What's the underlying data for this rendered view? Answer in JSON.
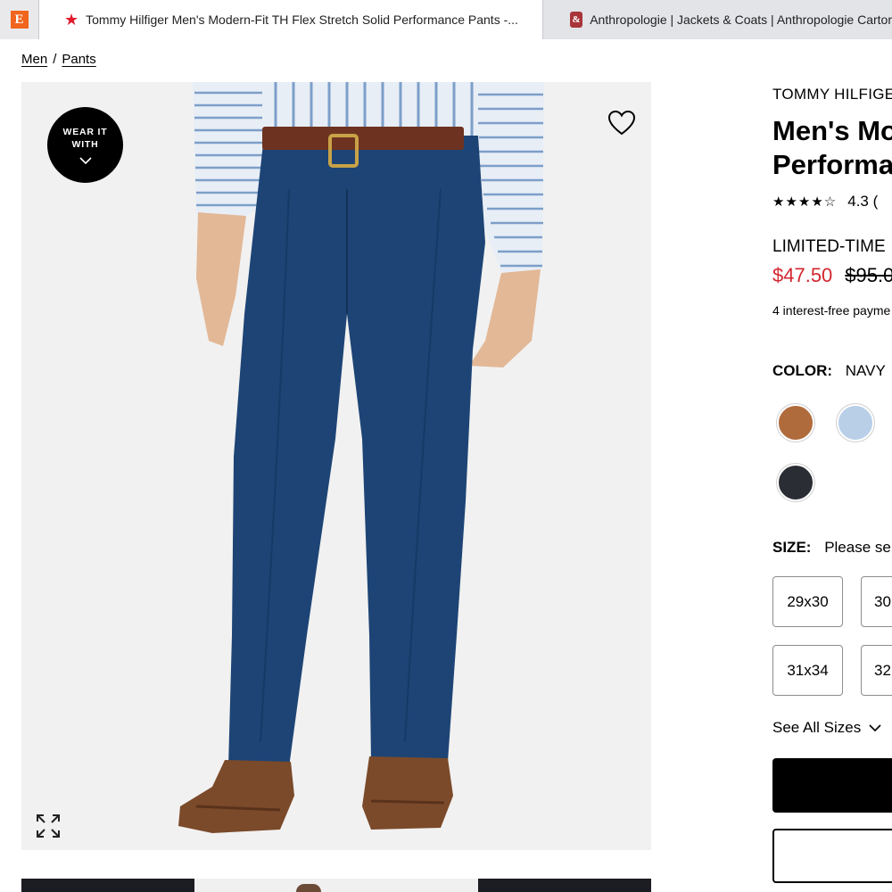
{
  "tabs": [
    {
      "title": "",
      "icon": "etsy-icon"
    },
    {
      "title": "Tommy Hilfiger Men's Modern-Fit TH Flex Stretch Solid Performance Pants -...",
      "icon": "macys-star-icon"
    },
    {
      "title": "Anthropologie | Jackets & Coats | Anthropologie Cartor",
      "icon": "anthropologie-icon"
    }
  ],
  "breadcrumb": [
    "Men",
    "Pants"
  ],
  "hero": {
    "wear_it_line1": "WEAR IT",
    "wear_it_line2": "WITH"
  },
  "product": {
    "brand": "TOMMY HILFIGE",
    "title_line1": "Men's Mo",
    "title_line2": "Performa",
    "rating": "4.3 (",
    "rating_value": 4.3,
    "promo": "LIMITED-TIME",
    "sale_price": "$47.50",
    "original_price": "$95.0",
    "installments": "4 interest-free payme",
    "color_label": "COLOR:",
    "color_value": "NAVY",
    "swatches": [
      {
        "name": "brown",
        "color": "#b06b3c"
      },
      {
        "name": "light-blue",
        "color": "#b9cfe8"
      },
      {
        "name": "charcoal",
        "color": "#2a2d33"
      }
    ],
    "size_label": "SIZE:",
    "size_prompt": "Please sel",
    "sizes": [
      "29x30",
      "30",
      "31x34",
      "32"
    ],
    "see_all": "See All Sizes"
  },
  "colors": {
    "sale": "#d22630",
    "navy_pants": "#1d4475"
  }
}
